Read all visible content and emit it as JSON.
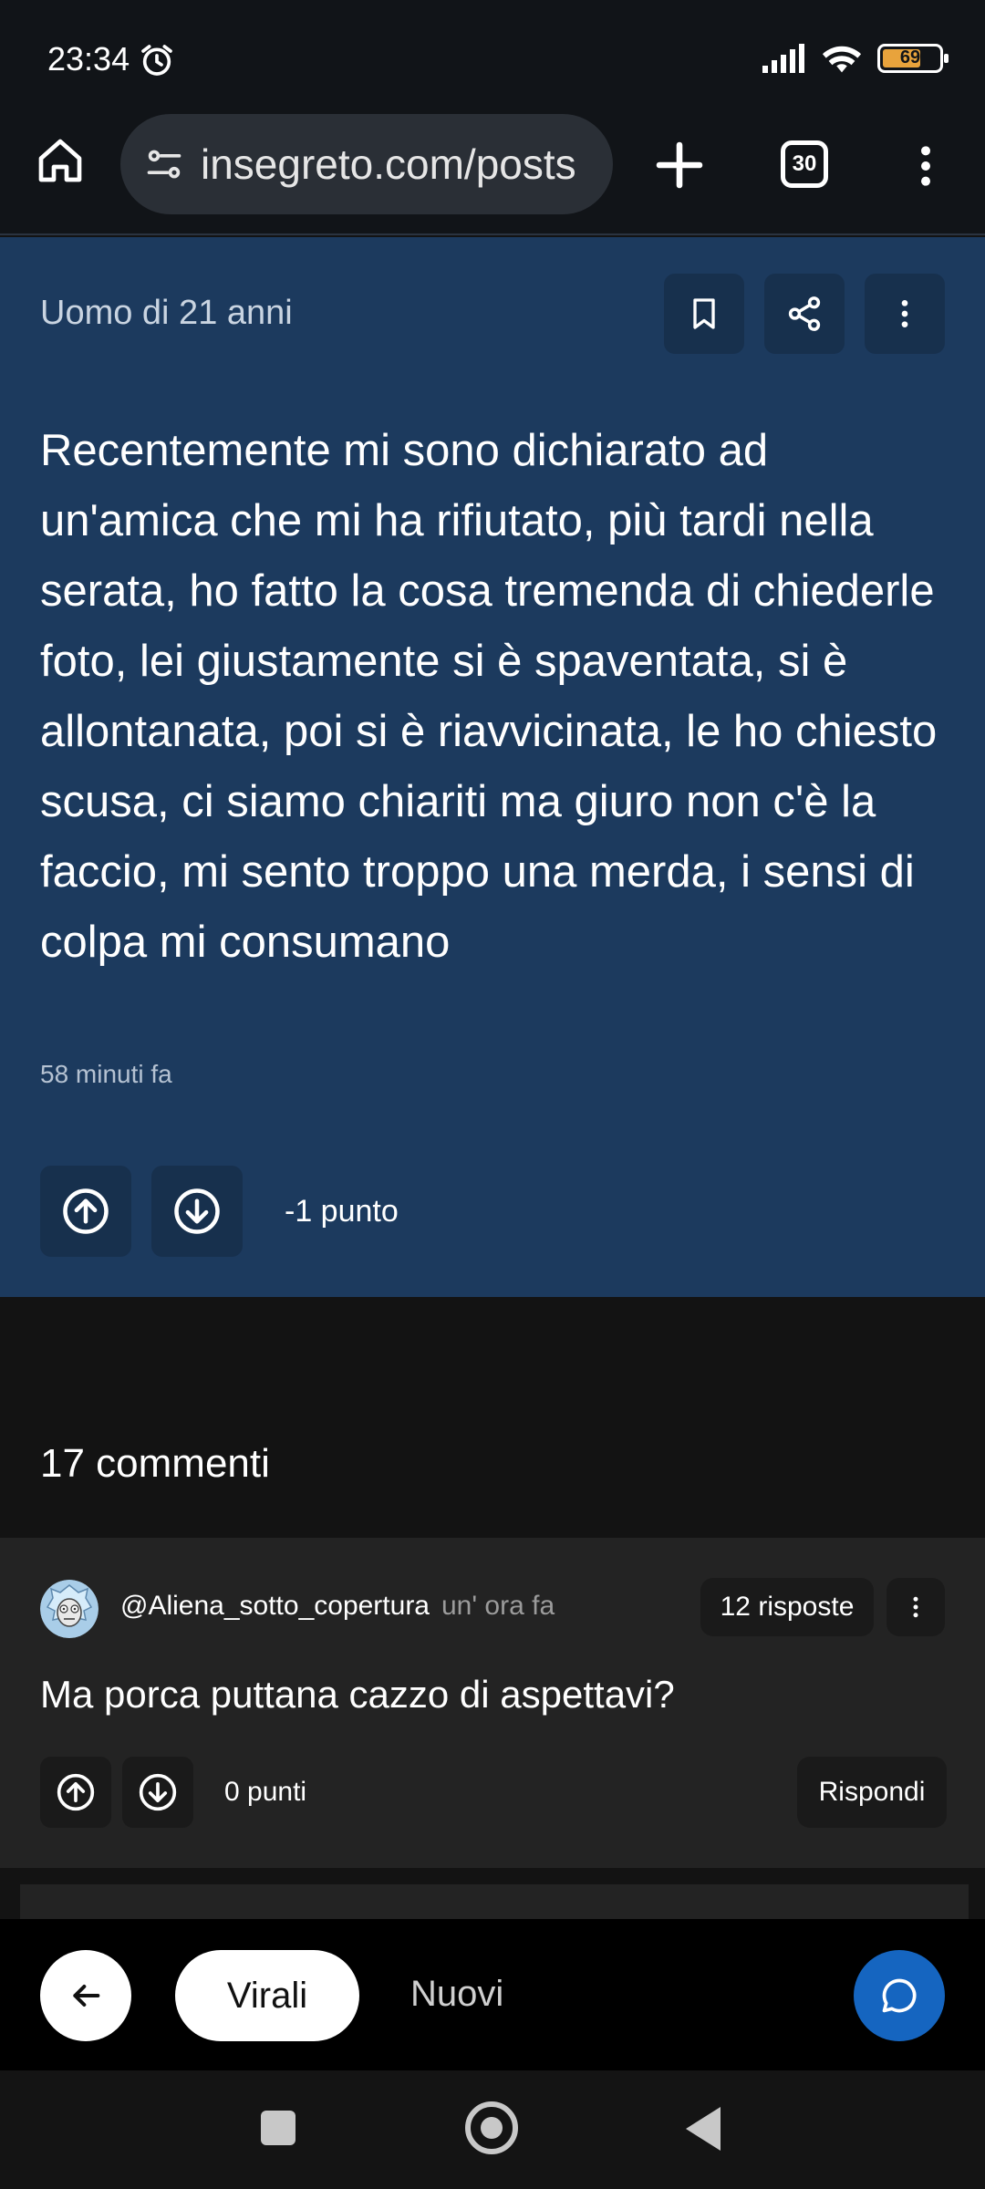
{
  "status_bar": {
    "time": "23:34",
    "battery": "69",
    "battery_level": 0.69,
    "icons": [
      "alarm-icon",
      "signal-icon",
      "wifi-icon",
      "battery-icon"
    ]
  },
  "browser": {
    "url": "insegreto.com/posts",
    "tab_count": "30"
  },
  "post": {
    "author": "Uomo di 21 anni",
    "body": "Recentemente mi sono dichiarato ad un'amica che mi ha rifiutato, più tardi nella serata, ho fatto la cosa tremenda di chiederle foto, lei giustamente si è spaventata, si è allontanata, poi si è riavvicinata, le ho chiesto scusa, ci siamo chiariti ma giuro non c'è la faccio, mi sento troppo una merda, i sensi di colpa mi consumano",
    "time": "58 minuti fa",
    "score": "-1 punto",
    "actions": [
      "bookmark-icon",
      "share-icon",
      "more-vert-icon"
    ]
  },
  "comments": {
    "count_label": "17 commenti",
    "items": [
      {
        "user": "@Aliena_sotto_copertura",
        "time": "un' ora fa",
        "replies": "12 risposte",
        "text": "Ma porca puttana cazzo di aspettavi?",
        "score": "0 punti",
        "reply_label": "Rispondi"
      }
    ]
  },
  "bottom_bar": {
    "tab_active": "Virali",
    "tab_other": "Nuovi"
  },
  "colors": {
    "post_bg": "#1c3a5e",
    "button_bg": "#17304d",
    "fab": "#1565c0",
    "comment_bg": "#232323"
  }
}
